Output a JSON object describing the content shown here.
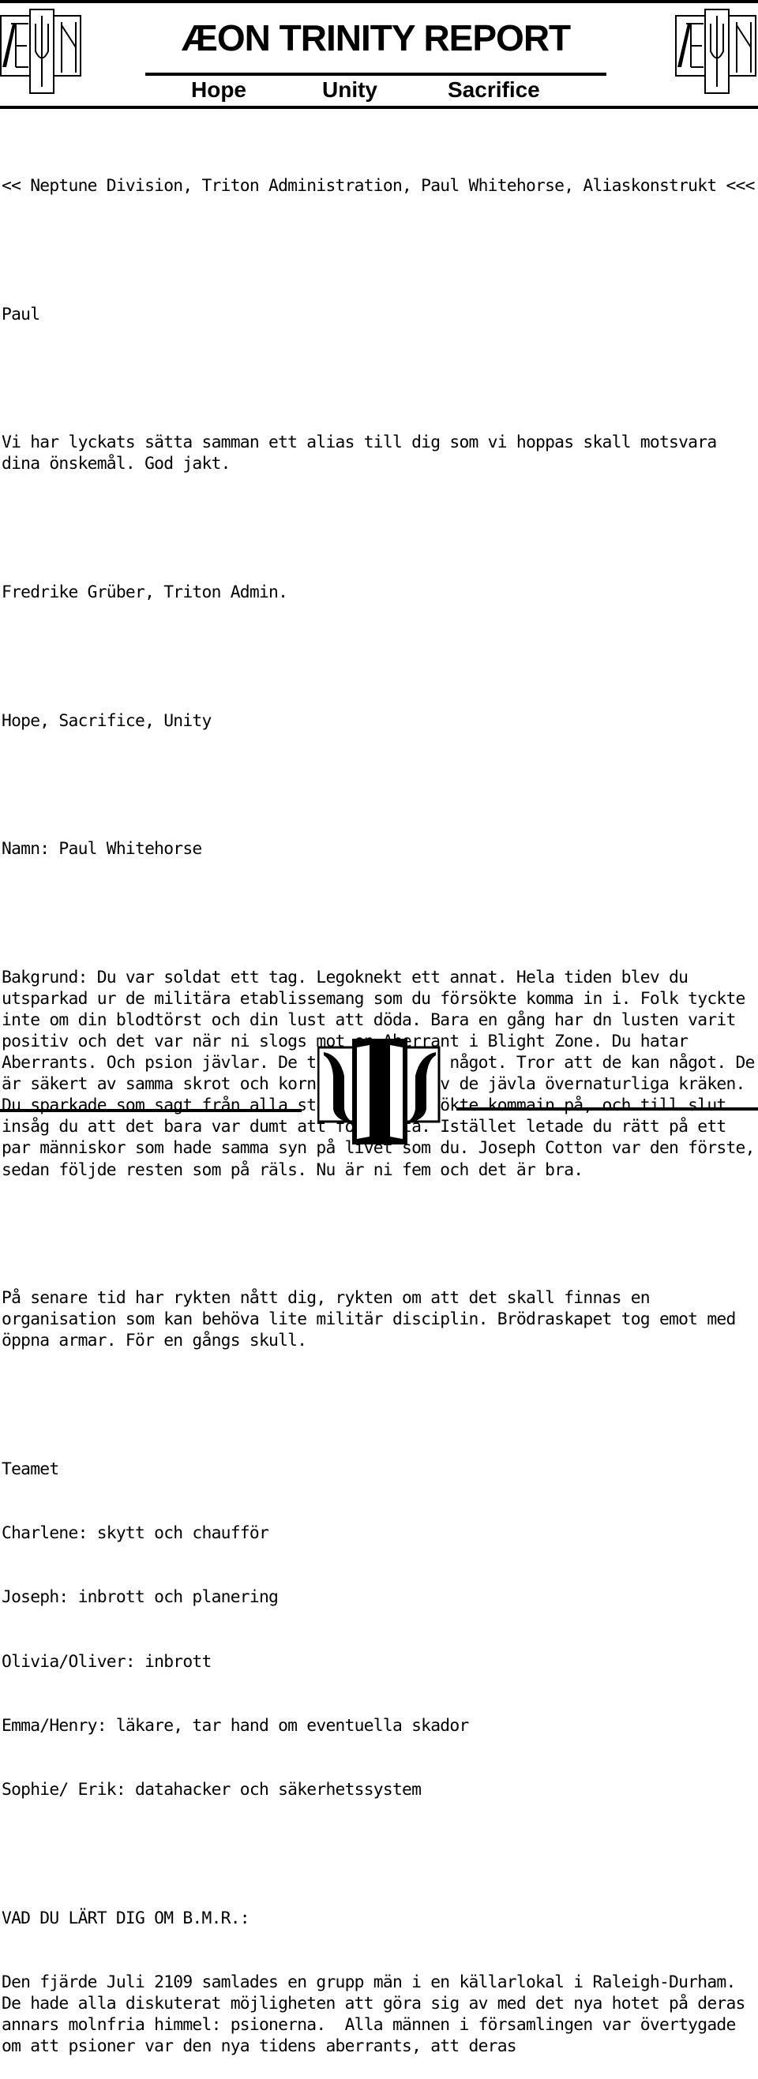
{
  "header": {
    "title": "ÆON TRINITY REPORT",
    "mottos": [
      "Hope",
      "Unity",
      "Sacrifice"
    ],
    "logo_left": "aeon-logo",
    "logo_right": "aeon-logo"
  },
  "document": {
    "subject_line": "<< Neptune Division, Triton Administration, Paul Whitehorse, Aliaskonstrukt <<<",
    "greeting": "Paul",
    "intro": "Vi har lyckats sätta samman ett alias till dig som vi hoppas skall motsvara dina önskemål. God jakt.",
    "signature": "Fredrike Grüber, Triton Admin.",
    "motto_line": "Hope, Sacrifice, Unity",
    "name_line": "Namn: Paul Whitehorse",
    "background": "Bakgrund: Du var soldat ett tag. Legoknekt ett annat. Hela tiden blev du utsparkad ur de militära etablissemang som du försökte komma in i. Folk tyckte inte om din blodtörst och din lust att döda. Bara en gång har dn lusten varit positiv och det var när ni slogs mot en Aberrant i Blight Zone. Du hatar Aberrants. Och psion jävlar. De tror att de är något. Tror att de kan något. De är säkert av samma skrot och korn som resten av de jävla övernaturliga kräken. Du sparkade som sagt från alla ställen du försökte kommain på, och till slut insåg du att det bara var dumt att fortsätta. Istället letade du rätt på ett par människor som hade samma syn på livet som du. Joseph Cotton var den förste, sedan följde resten som på räls. Nu är ni fem och det är bra.",
    "recent": "På senare tid har rykten nått dig, rykten om att det skall finnas en organisation som kan behöva lite militär disciplin. Brödraskapet tog emot med öppna armar. För en gångs skull.",
    "team_heading": "Teamet",
    "team": [
      "Charlene: skytt och chaufför",
      "Joseph: inbrott och planering",
      "Olivia/Oliver: inbrott",
      "Emma/Henry: läkare, tar hand om eventuella skador",
      "Sophie/ Erik: datahacker och säkerhetssystem"
    ],
    "bmr_heading": "VAD DU LÄRT DIG OM B.M.R.:",
    "bmr_text": "Den fjärde Juli 2109 samlades en grupp män i en källarlokal i Raleigh-Durham. De hade alla diskuterat möjligheten att göra sig av med det nya hotet på deras annars molnfria himmel: psionerna.  Alla männen i församlingen var övertygade om att psioner var den nya tidens aberrants, att deras"
  },
  "footer": {
    "logo": "trinity-emblem"
  }
}
